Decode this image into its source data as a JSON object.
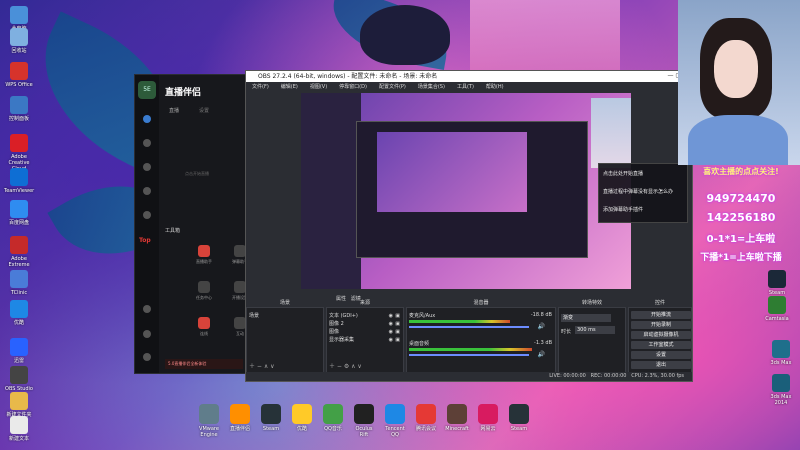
{
  "desktop": {
    "left_icons": [
      {
        "label": "此电脑",
        "icon": "computer-icon",
        "color": "#4a90d9"
      },
      {
        "label": "回收站",
        "icon": "recycle-bin-icon",
        "color": "#7fb0e0"
      },
      {
        "label": "WPS Office",
        "icon": "wps-icon",
        "color": "#d6332b"
      },
      {
        "label": "控制面板",
        "icon": "control-panel-icon",
        "color": "#3b78c4"
      },
      {
        "label": "Adobe Creative Cloud",
        "icon": "adobe-icon",
        "color": "#da1f26"
      },
      {
        "label": "TeamViewer",
        "icon": "teamviewer-icon",
        "color": "#0e6ed4"
      },
      {
        "label": "百度网盘",
        "icon": "baidu-netdisk-icon",
        "color": "#2f8cf0"
      },
      {
        "label": "Adobe Extreme",
        "icon": "adobe-extreme-icon",
        "color": "#c52a2a"
      },
      {
        "label": "TClinic",
        "icon": "tclinic-icon",
        "color": "#4a7cd8"
      },
      {
        "label": "优酷",
        "icon": "youku-icon",
        "color": "#1e88e5"
      },
      {
        "label": "迅雷",
        "icon": "xunlei-icon",
        "color": "#2962ff"
      },
      {
        "label": "OBS Studio",
        "icon": "obs-icon",
        "color": "#444"
      },
      {
        "label": "新建文件夹",
        "icon": "folder-icon",
        "color": "#e8b94a"
      },
      {
        "label": "新建文本",
        "icon": "text-file-icon",
        "color": "#eaeaea"
      }
    ],
    "right_icons": [
      {
        "label": "Steam",
        "icon": "steam-icon",
        "color": "#1b2838"
      },
      {
        "label": "Camtasia",
        "icon": "camtasia-icon",
        "color": "#2e7d32"
      },
      {
        "label": "3ds Max",
        "icon": "3dsmax-icon",
        "color": "#1f6f8b"
      },
      {
        "label": "3ds Max 2014",
        "icon": "3dsmax-2014-icon",
        "color": "#1a5f7a"
      }
    ],
    "taskbar_icons": [
      {
        "label": "VMware Engine",
        "icon": "vmware-icon",
        "color": "#607d8b"
      },
      {
        "label": "直播伴侣",
        "icon": "live-companion-icon",
        "color": "#ff8f00"
      },
      {
        "label": "Steam",
        "icon": "steam-icon",
        "color": "#263238"
      },
      {
        "label": "优酷",
        "icon": "youku-icon",
        "color": "#ffca28"
      },
      {
        "label": "QQ音乐",
        "icon": "qq-music-icon",
        "color": "#43a047"
      },
      {
        "label": "Oculus Rift",
        "icon": "rift-icon",
        "color": "#212121"
      },
      {
        "label": "Tencent QQ",
        "icon": "qq-icon",
        "color": "#1e88e5"
      },
      {
        "label": "腾讯会议",
        "icon": "tencent-meeting-icon",
        "color": "#e53935"
      },
      {
        "label": "Minecraft",
        "icon": "minecraft-icon",
        "color": "#5d4037"
      },
      {
        "label": "网易云",
        "icon": "netease-icon",
        "color": "#d81b60"
      },
      {
        "label": "Steam",
        "icon": "steam-icon",
        "color": "#263238"
      }
    ]
  },
  "zhibo": {
    "title": "直播伴侣",
    "tab1": "直播",
    "tab2": "设置",
    "hint": "点击开始直播",
    "section": "工具箱",
    "tools": [
      "直播助手",
      "弹幕助手",
      "任务中心",
      "开播设置",
      "连线",
      "互动"
    ],
    "banner": "5.0直播伴侣全新体验"
  },
  "obs": {
    "title": "OBS 27.2.4 (64-bit, windows) - 配置文件: 未命名 - 场景: 未命名",
    "menu": [
      "文件(F)",
      "编辑(E)",
      "视图(V)",
      "停靠窗口(D)",
      "配置文件(P)",
      "场景集合(S)",
      "工具(T)",
      "帮助(H)"
    ],
    "toolbar_properties": "属性",
    "toolbar_filters": "滤镜",
    "docks": {
      "scenes": {
        "title": "场景",
        "items": [
          "场景"
        ]
      },
      "sources": {
        "title": "来源",
        "items": [
          "文本 (GDI+)",
          "图像 2",
          "图像",
          "显示器采集"
        ]
      },
      "mixer": {
        "title": "混音器",
        "tracks": [
          {
            "name": "麦克风/Aux",
            "db": "-18.8 dB",
            "level": 0.72
          },
          {
            "name": "桌面音频",
            "db": "-1.3 dB",
            "level": 0.88
          }
        ]
      },
      "transitions": {
        "title": "转场特效",
        "type": "渐变",
        "duration_label": "时长",
        "duration": "300 ms"
      },
      "controls": {
        "title": "控件",
        "buttons": [
          "开始推流",
          "开始录制",
          "启动虚拟摄像机",
          "工作室模式",
          "设置",
          "退出"
        ]
      }
    },
    "status": {
      "live": "LIVE: 00:00:00",
      "rec": "REC: 00:00:00",
      "cpu": "CPU: 2.3%, 30.00 fps"
    }
  },
  "overlay": {
    "follow": "喜欢主播的点点关注!",
    "qq1": "949724470",
    "qq2": "142256180",
    "line1": "0-1*1=上车啦",
    "line2": "下播*1=上车啦下播"
  },
  "popup": {
    "items": [
      "点击此处开始直播",
      "直播过程中弹幕没有显示怎么办",
      "添加弹幕助手插件"
    ]
  }
}
